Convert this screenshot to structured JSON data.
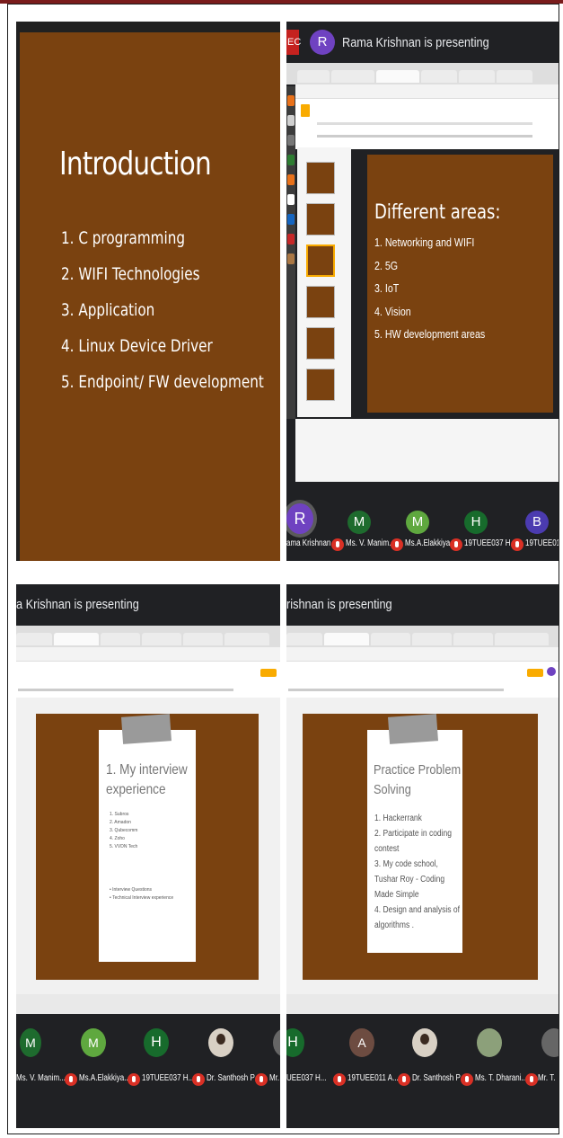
{
  "panel1": {
    "slide_title": "Introduction",
    "items": [
      "1.  C programming",
      "2.  WIFI Technologies",
      "3.  Application",
      "4.  Linux Device Driver",
      "5.  Endpoint/ FW development"
    ]
  },
  "panel2": {
    "ec_badge": "EC",
    "presenter_initial": "R",
    "presenting_text": "Rama Krishnan is presenting",
    "slide_title": "Different areas:",
    "items": [
      "1.  Networking and WIFI",
      "2.  5G",
      "3.  IoT",
      "4.  Vision",
      "5.  HW development areas"
    ],
    "participants": [
      {
        "initial": "R",
        "name": "ama Krishnan",
        "color": "#6f42c1"
      },
      {
        "initial": "M",
        "name": "Ms. V. Manim...",
        "color": "#1e6b2e"
      },
      {
        "initial": "M",
        "name": "Ms.A.Elakkiya...",
        "color": "#5fa83f"
      },
      {
        "initial": "H",
        "name": "19TUEE037 H...",
        "color": "#176b2c"
      },
      {
        "initial": "B",
        "name": "19TUEE01(",
        "color": "#4b3bb0"
      }
    ]
  },
  "panel3": {
    "presenting_text": "a Krishnan is presenting",
    "card_title": "1. My interview experience",
    "items": [
      "1.   Subros",
      "2.   Amadon",
      "3.   Qubecomm",
      "4.   Zoho",
      "5.   VVDN Tech"
    ],
    "bullets": [
      "Interview Questions",
      "Technical Interview experience"
    ],
    "participants": [
      {
        "initial": "M",
        "name": "Ms. V. Manim...",
        "color": "#1e6b2e"
      },
      {
        "initial": "M",
        "name": "Ms.A.Elakkiya...",
        "color": "#5fa83f"
      },
      {
        "initial": "H",
        "name": "19TUEE037 H...",
        "color": "#176b2c"
      },
      {
        "initial": "",
        "name": "Dr. Santhosh P",
        "color": "#d8d0c4"
      },
      {
        "initial": "",
        "name": "Mr.",
        "color": "#666666"
      }
    ]
  },
  "panel4": {
    "presenting_text": "rishnan is presenting",
    "card_title": "Practice Problem Solving",
    "items": [
      "1.  Hackerrank",
      "2.  Participate in coding contest",
      "3.  My code school, Tushar Roy - Coding Made Simple",
      "4.  Design and analysis of algorithms ."
    ],
    "participants": [
      {
        "initial": "H",
        "name": "UEE037 H...",
        "color": "#176b2c"
      },
      {
        "initial": "A",
        "name": "19TUEE011 A...",
        "color": "#6d4c41"
      },
      {
        "initial": "",
        "name": "Dr. Santhosh P",
        "color": "#d8d0c4"
      },
      {
        "initial": "",
        "name": "Ms. T. Dharani...",
        "color": "#8ca07a"
      },
      {
        "initial": "",
        "name": "Mr. T.",
        "color": "#666666"
      }
    ]
  },
  "colors": {
    "slide_brown": "#7a4210",
    "meet_dark": "#202124",
    "mic_red": "#d93025",
    "present_button": "#f9ab00"
  }
}
